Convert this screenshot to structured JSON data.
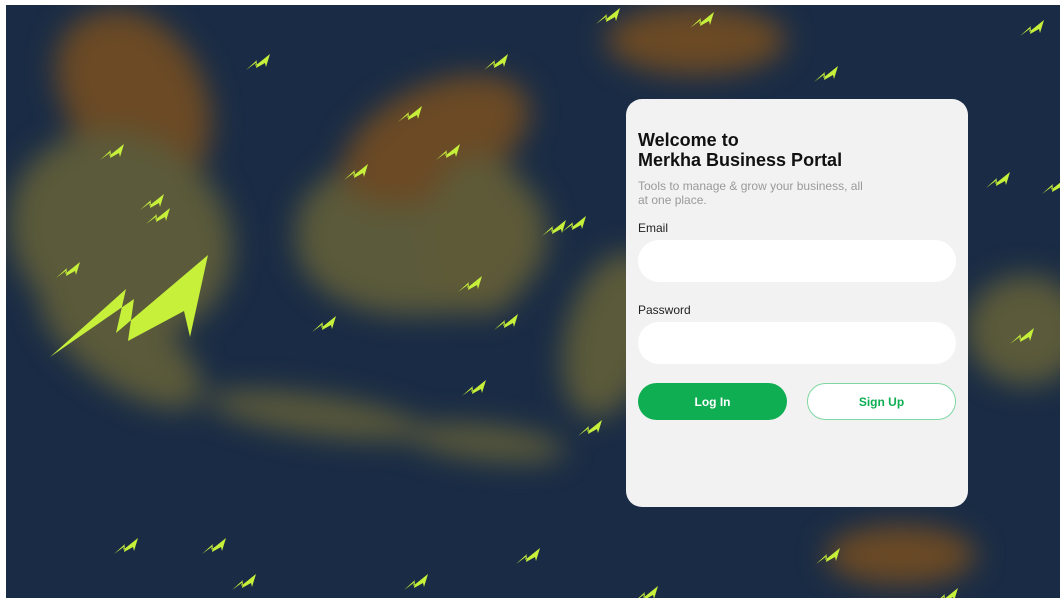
{
  "colors": {
    "background_sea": "#1a2c45",
    "land": "#5b5a3a",
    "land_dark": "#6b4a25",
    "bolt": "#c6f03a",
    "card_bg": "#f2f2f2",
    "primary_green": "#0fae52"
  },
  "background": {
    "icon": "lightning-bolt-icon",
    "logo_icon": "merkha-bolt-logo"
  },
  "login_card": {
    "title_line1": "Welcome to",
    "title_line2": "Merkha Business Portal",
    "subtitle": "Tools to manage & grow your business, all at one place.",
    "email_label": "Email",
    "email_value": "",
    "email_placeholder": "",
    "password_label": "Password",
    "password_value": "",
    "password_placeholder": "",
    "login_button": "Log In",
    "signup_button": "Sign Up"
  }
}
